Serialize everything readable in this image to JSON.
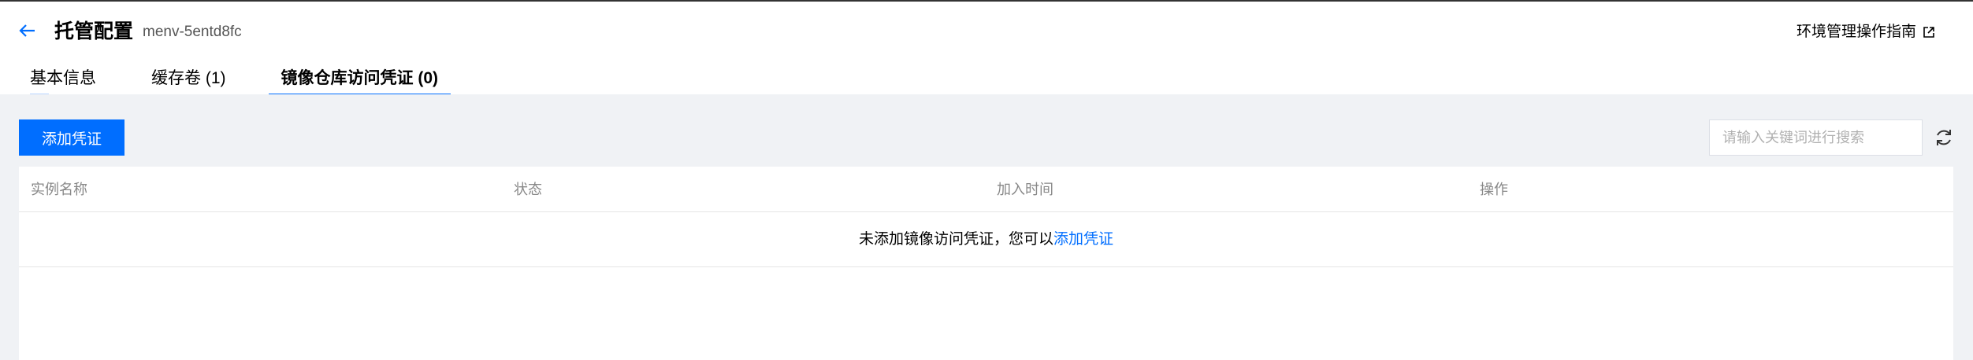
{
  "header": {
    "title": "托管配置",
    "env_id": "menv-5entd8fc",
    "guide_label": "环境管理操作指南"
  },
  "tabs": [
    {
      "label": "基本信息"
    },
    {
      "label": "缓存卷 (1)"
    },
    {
      "label": "镜像仓库访问凭证 (0)"
    }
  ],
  "toolbar": {
    "add_label": "添加凭证",
    "search_placeholder": "请输入关键词进行搜索"
  },
  "table": {
    "columns": [
      "实例名称",
      "状态",
      "加入时间",
      "操作"
    ],
    "empty_text": "未添加镜像访问凭证，您可以",
    "empty_link": "添加凭证"
  },
  "colors": {
    "accent": "#006eff",
    "background": "#f0f2f5"
  }
}
